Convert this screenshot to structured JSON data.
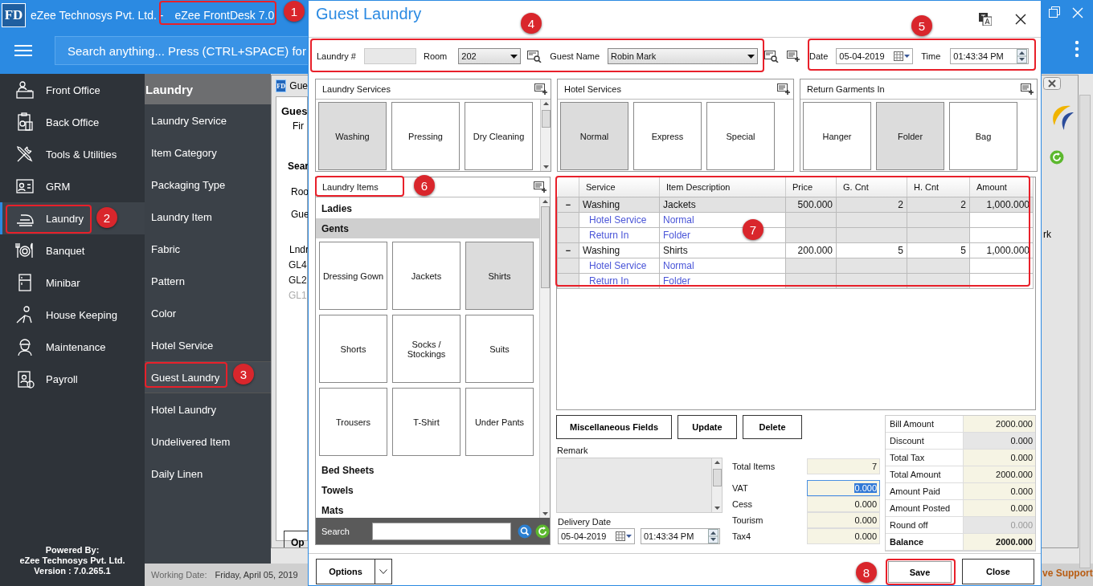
{
  "app": {
    "logo": "FD",
    "title": "eZee Technosys Pvt. Ltd. -",
    "product": "eZee FrontDesk 7.0",
    "search_placeholder": "Search anything... Press (CTRL+SPACE) for"
  },
  "sidebar": {
    "items": [
      {
        "label": "Front Office",
        "selected": false
      },
      {
        "label": "Back Office",
        "selected": false
      },
      {
        "label": "Tools & Utilities",
        "selected": false
      },
      {
        "label": "GRM",
        "selected": false
      },
      {
        "label": "Laundry",
        "selected": true
      },
      {
        "label": "Banquet",
        "selected": false
      },
      {
        "label": "Minibar",
        "selected": false
      },
      {
        "label": "House Keeping",
        "selected": false
      },
      {
        "label": "Maintenance",
        "selected": false
      },
      {
        "label": "Payroll",
        "selected": false
      }
    ],
    "footer": [
      "Powered By:",
      "eZee Technosys Pvt. Ltd.",
      "Version : 7.0.265.1"
    ]
  },
  "submenu": {
    "title": "Laundry",
    "items": [
      {
        "label": "Laundry Service",
        "selected": false
      },
      {
        "label": "Item Category",
        "selected": false
      },
      {
        "label": "Packaging Type",
        "selected": false
      },
      {
        "label": "Laundry Item",
        "selected": false
      },
      {
        "label": "Fabric",
        "selected": false
      },
      {
        "label": "Pattern",
        "selected": false
      },
      {
        "label": "Color",
        "selected": false
      },
      {
        "label": "Hotel Service",
        "selected": false
      },
      {
        "label": "Guest Laundry",
        "selected": true
      },
      {
        "label": "Hotel Laundry",
        "selected": false
      },
      {
        "label": "Undelivered Item",
        "selected": false
      },
      {
        "label": "Daily Linen",
        "selected": false
      }
    ]
  },
  "status_bar": {
    "label": "Working Date:",
    "value": "Friday, April 05, 2019"
  },
  "background_window": {
    "logo": "FD",
    "title": "Gue",
    "heading": "Gues",
    "subheading": "Fir",
    "search_title": "Sear",
    "fields": [
      "Roo",
      "Gue"
    ],
    "list_header": "Lndr",
    "rows": [
      {
        "text": "GL4",
        "dimmed": false
      },
      {
        "text": "GL2",
        "dimmed": false
      },
      {
        "text": "GL1",
        "dimmed": true
      }
    ],
    "button": "Op",
    "right_header": "rk",
    "live_support": "ve Support"
  },
  "dialog": {
    "title": "Guest Laundry",
    "header": {
      "laundry_label": "Laundry #",
      "room_label": "Room",
      "room": "202",
      "guest_label": "Guest Name",
      "guest": "Robin Mark",
      "date_label": "Date",
      "date": "05-04-2019",
      "time_label": "Time",
      "time": "01:43:34 PM"
    },
    "panels": [
      {
        "title": "Laundry Services",
        "tiles": [
          {
            "label": "Washing",
            "selected": true
          },
          {
            "label": "Pressing",
            "selected": false
          },
          {
            "label": "Dry Cleaning",
            "selected": false
          }
        ]
      },
      {
        "title": "Hotel Services",
        "tiles": [
          {
            "label": "Normal",
            "selected": true
          },
          {
            "label": "Express",
            "selected": false
          },
          {
            "label": "Special",
            "selected": false
          }
        ]
      },
      {
        "title": "Return Garments In",
        "tiles": [
          {
            "label": "Hanger",
            "selected": false
          },
          {
            "label": "Folder",
            "selected": true
          },
          {
            "label": "Bag",
            "selected": false
          }
        ]
      }
    ],
    "laundry_items": {
      "title": "Laundry Items",
      "categories_above": [
        {
          "label": "Ladies",
          "selected": false
        },
        {
          "label": "Gents",
          "selected": true
        }
      ],
      "tiles": [
        {
          "label": "Dressing Gown",
          "selected": false
        },
        {
          "label": "Jackets",
          "selected": false
        },
        {
          "label": "Shirts",
          "selected": true
        },
        {
          "label": "Shorts",
          "selected": false
        },
        {
          "label": "Socks / Stockings",
          "selected": false
        },
        {
          "label": "Suits",
          "selected": false
        },
        {
          "label": "Trousers",
          "selected": false
        },
        {
          "label": "T-Shirt",
          "selected": false
        },
        {
          "label": "Under Pants",
          "selected": false
        }
      ],
      "categories_below": [
        {
          "label": "Bed Sheets",
          "selected": false
        },
        {
          "label": "Towels",
          "selected": false
        },
        {
          "label": "Mats",
          "selected": false
        }
      ],
      "search_label": "Search"
    },
    "grid": {
      "columns": [
        "Service",
        "Item Description",
        "Price",
        "G. Cnt",
        "H. Cnt",
        "Amount"
      ],
      "rows": [
        {
          "kind": "item",
          "toggle": "−",
          "selected": true,
          "cells": [
            "Washing",
            "Jackets",
            "500.000",
            "2",
            "2",
            "1,000.000"
          ]
        },
        {
          "kind": "detail",
          "selected": false,
          "cells": [
            "Hotel Service",
            "Normal"
          ]
        },
        {
          "kind": "detail",
          "selected": false,
          "cells": [
            "Return In",
            "Folder"
          ]
        },
        {
          "kind": "item",
          "toggle": "−",
          "selected": false,
          "cells": [
            "Washing",
            "Shirts",
            "200.000",
            "5",
            "5",
            "1,000.000"
          ]
        },
        {
          "kind": "detail",
          "selected": false,
          "cells": [
            "Hotel Service",
            "Normal"
          ]
        },
        {
          "kind": "detail",
          "selected": false,
          "cells": [
            "Return In",
            "Folder"
          ]
        }
      ]
    },
    "buttons": [
      "Miscellaneous Fields",
      "Update",
      "Delete"
    ],
    "remark_label": "Remark",
    "delivery": {
      "label": "Delivery Date",
      "date": "05-04-2019",
      "time": "01:43:34 PM"
    },
    "taxes": [
      {
        "label": "Total Items",
        "value": "7",
        "selected": false
      },
      {
        "label": "VAT",
        "value": "0.000",
        "selected": true
      },
      {
        "label": "Cess",
        "value": "0.000",
        "selected": false
      },
      {
        "label": "Tourism",
        "value": "0.000",
        "selected": false
      },
      {
        "label": "Tax4",
        "value": "0.000",
        "selected": false
      }
    ],
    "totals": [
      {
        "label": "Bill Amount",
        "value": "2000.000",
        "kind": "input"
      },
      {
        "label": "Discount",
        "value": "0.000",
        "kind": "readonly"
      },
      {
        "label": "Total Tax",
        "value": "0.000",
        "kind": "input"
      },
      {
        "label": "Total Amount",
        "value": "2000.000",
        "kind": "input"
      },
      {
        "label": "Amount Paid",
        "value": "0.000",
        "kind": "input"
      },
      {
        "label": "Amount Posted",
        "value": "0.000",
        "kind": "input"
      },
      {
        "label": "Round off",
        "value": "0.000",
        "kind": "disabled"
      },
      {
        "label": "Balance",
        "value": "2000.000",
        "kind": "total"
      }
    ],
    "footer": {
      "options": "Options",
      "save": "Save",
      "close": "Close"
    }
  },
  "annotations": [
    {
      "number": "1"
    },
    {
      "number": "2"
    },
    {
      "number": "3"
    },
    {
      "number": "4"
    },
    {
      "number": "5"
    },
    {
      "number": "6"
    },
    {
      "number": "7"
    },
    {
      "number": "8"
    }
  ]
}
